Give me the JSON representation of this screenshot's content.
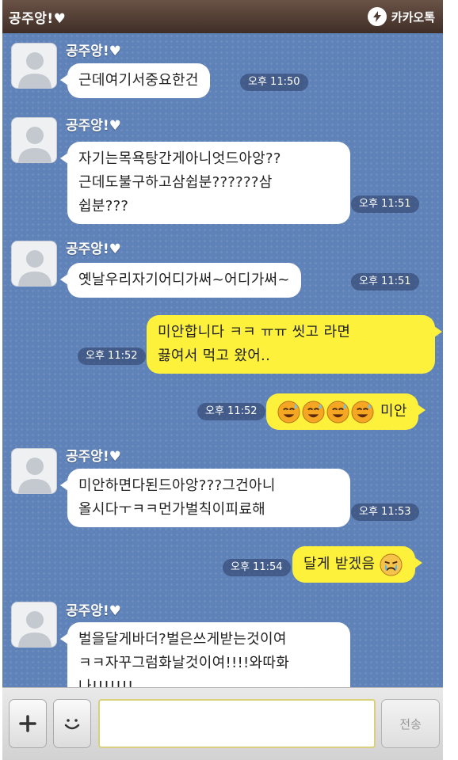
{
  "header": {
    "title": "공주앙!♥",
    "brand": "카카오톡"
  },
  "messages": [
    {
      "sender": "공주앙!♥",
      "text": "근데여기서중요한건",
      "time": "오후 11:50"
    },
    {
      "sender": "공주앙!♥",
      "text": "자기는목욕탕간게아니엇드아앙??\n근데도불구하고삼쉽분??????삼\n쉽분???",
      "time": "오후 11:51"
    },
    {
      "sender": "공주앙!♥",
      "text": "옛날우리자기어디가써~어디가써~",
      "time": "오후 11:51"
    },
    {
      "text": "미안합니다 ㅋㅋ ㅠㅠ 씻고 라면\n끓여서 먹고 왔어..",
      "time": "오후 11:52"
    },
    {
      "text": "미안",
      "time": "오후 11:52",
      "emoticon": "sweat-smile-emoticon"
    },
    {
      "sender": "공주앙!♥",
      "text": "미안하면다된드아앙???그건아니\n올시다ㅜㅋㅋ먼가벌칙이피료해",
      "time": "오후 11:53"
    },
    {
      "text": "달게 받겠음",
      "time": "오후 11:54",
      "emoticon": "crying-emoticon"
    },
    {
      "sender": "공주앙!♥",
      "text": "벌을달게바더?벌은쓰게받는것이여\nㅋㅋ자꾸그럼화날것이여!!!!와따화\n나!!!!!!!"
    }
  ],
  "input": {
    "placeholder": "",
    "send_label": "전송",
    "plus_icon": "plus-icon",
    "emoticon_icon": "smiley-icon"
  },
  "colors": {
    "chat_bg": "#5f82b8",
    "outgoing_bubble": "#fef13b",
    "incoming_bubble": "#ffffff",
    "header_bg": "#4f3c32"
  }
}
